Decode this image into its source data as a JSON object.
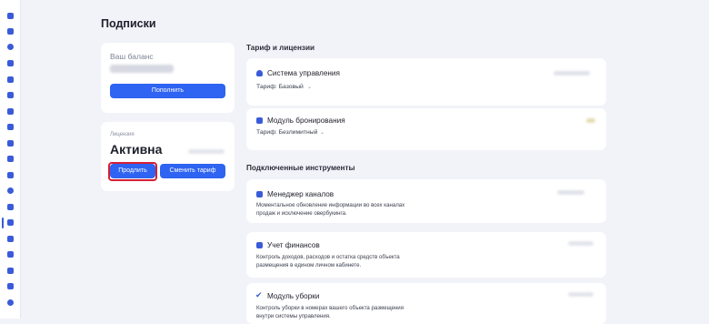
{
  "page": {
    "title": "Подписки"
  },
  "balance": {
    "label": "Ваш баланс",
    "topup_button": "Пополнить"
  },
  "license": {
    "label": "Лицензия",
    "status": "Активна",
    "extend_button": "Продлить",
    "change_tariff_button": "Сменить тариф"
  },
  "tariffs": {
    "heading": "Тариф и лицензии",
    "items": [
      {
        "title": "Система управления",
        "tariff": "Тариф: Базовый"
      },
      {
        "title": "Модуль бронирования",
        "tariff": "Тариф: Безлимитный"
      }
    ]
  },
  "tools": {
    "heading": "Подключенные инструменты",
    "items": [
      {
        "title": "Менеджер каналов",
        "desc1": "Моментальное обновление информации во всех каналах",
        "desc2": "продаж и исключение овербукинга."
      },
      {
        "title": "Учет финансов",
        "desc1": "Контроль доходов, расходов и остатка средств объекта",
        "desc2": "размещения в едином личном кабинете."
      },
      {
        "title": "Модуль уборки",
        "desc1": "Контроль уборки в номерах вашего объекта размещения",
        "desc2": "внутри системы управления."
      }
    ]
  },
  "sidebar": {
    "icons": [
      "home-icon",
      "calendar-icon",
      "user-icon",
      "grid-icon",
      "tag-icon",
      "document-icon",
      "copy-icon",
      "chart-icon",
      "inbox-icon",
      "rocket-icon",
      "check-icon",
      "gear-icon",
      "mail-icon",
      "wallet-icon",
      "database-icon",
      "puzzle-icon",
      "cloud-icon",
      "megaphone-icon",
      "person-icon"
    ]
  },
  "colors": {
    "accent": "#2f63f1",
    "highlight": "#d61f34",
    "background": "#f2f3f8"
  }
}
